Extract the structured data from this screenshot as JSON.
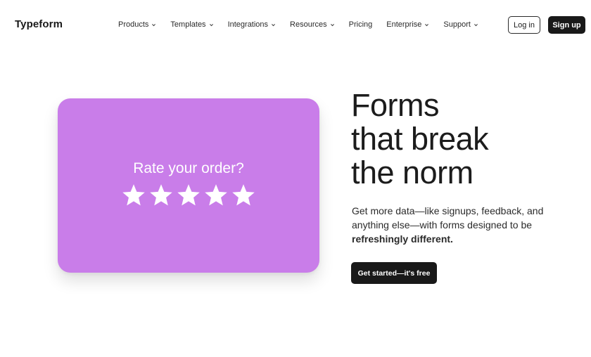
{
  "header": {
    "logo": "Typeform",
    "nav": [
      {
        "label": "Products",
        "has_dropdown": true
      },
      {
        "label": "Templates",
        "has_dropdown": true
      },
      {
        "label": "Integrations",
        "has_dropdown": true
      },
      {
        "label": "Resources",
        "has_dropdown": true
      },
      {
        "label": "Pricing",
        "has_dropdown": false
      },
      {
        "label": "Enterprise",
        "has_dropdown": true
      },
      {
        "label": "Support",
        "has_dropdown": true
      }
    ],
    "login_label": "Log in",
    "signup_label": "Sign up"
  },
  "card": {
    "title": "Rate your order?",
    "stars": 5,
    "background": "#c97de9"
  },
  "hero": {
    "headline_lines": [
      "Forms",
      "that break",
      "the norm"
    ],
    "subtext_plain": "Get more data—like signups, feedback, and anything else—with forms designed to be",
    "subtext_bold": "refreshingly different.",
    "cta_label": "Get started—it's free"
  },
  "colors": {
    "dark_button": "#191919",
    "card_purple": "#c97de9",
    "text": "#1a1a1a"
  }
}
